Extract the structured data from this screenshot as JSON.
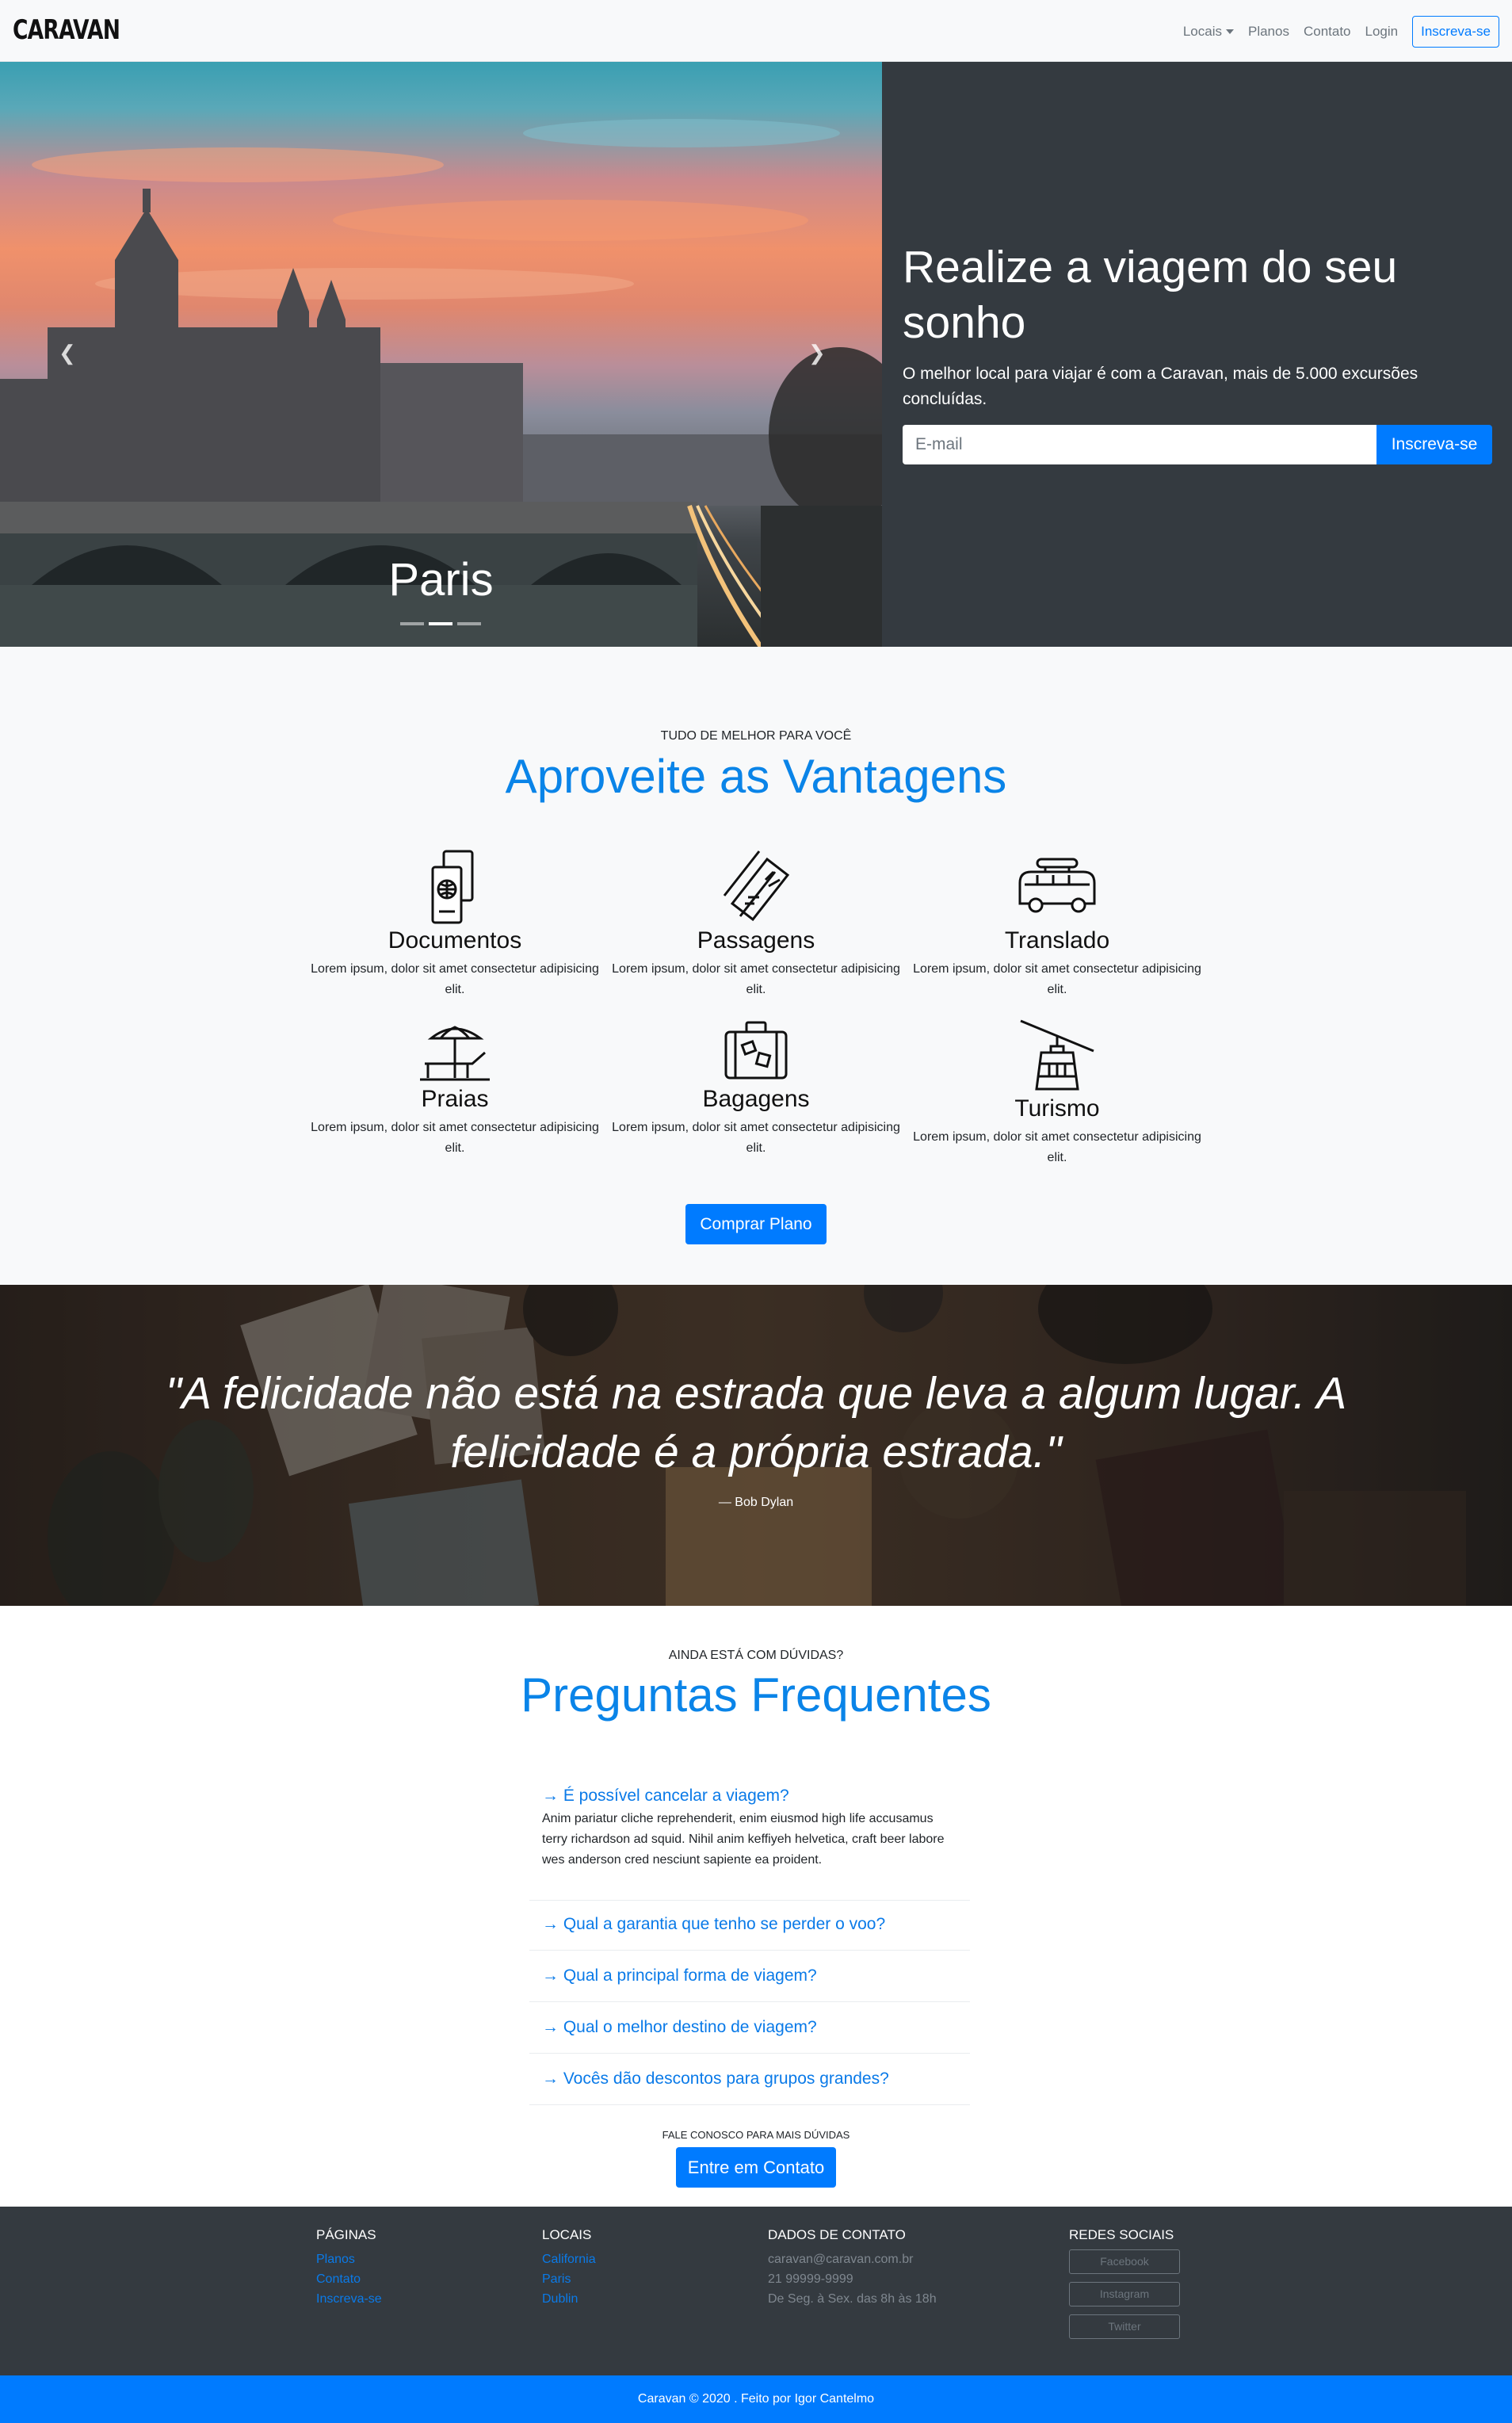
{
  "navbar": {
    "brand": "CARAVAN",
    "items": [
      {
        "label": "Locais",
        "dropdown": true
      },
      {
        "label": "Planos"
      },
      {
        "label": "Contato"
      },
      {
        "label": "Login"
      }
    ],
    "cta_label": "Inscreva-se"
  },
  "hero": {
    "carousel_caption": "Paris",
    "prev_icon": "chevron-left-icon",
    "next_icon": "chevron-right-icon",
    "slides": 3,
    "active_slide": 2,
    "title": "Realize a viagem do seu sonho",
    "subtitle": "O melhor local para viajar é com a Caravan, mais de 5.000 excursões concluídas.",
    "email_placeholder": "E-mail",
    "submit_label": "Inscreva-se"
  },
  "features": {
    "eyebrow": "TUDO DE MELHOR PARA VOCÊ",
    "title": "Aproveite as Vantagens",
    "items": [
      {
        "icon": "passport-icon",
        "title": "Documentos",
        "text": "Lorem ipsum, dolor sit amet consectetur adipisicing elit."
      },
      {
        "icon": "ticket-icon",
        "title": "Passagens",
        "text": "Lorem ipsum, dolor sit amet consectetur adipisicing elit."
      },
      {
        "icon": "van-icon",
        "title": "Translado",
        "text": "Lorem ipsum, dolor sit amet consectetur adipisicing elit."
      },
      {
        "icon": "beach-umbrella-icon",
        "title": "Praias",
        "text": "Lorem ipsum, dolor sit amet consectetur adipisicing elit."
      },
      {
        "icon": "suitcase-icon",
        "title": "Bagagens",
        "text": "Lorem ipsum, dolor sit amet consectetur adipisicing elit."
      },
      {
        "icon": "cable-car-icon",
        "title": "Turismo",
        "text": "Lorem ipsum, dolor sit amet consectetur adipisicing elit."
      }
    ],
    "button_label": "Comprar Plano"
  },
  "quote": {
    "text": "\"A felicidade não está na estrada que leva a algum lugar. A felicidade é a própria estrada.\"",
    "author": "— Bob Dylan"
  },
  "faq": {
    "eyebrow": "AINDA ESTÁ COM DÚVIDAS?",
    "title": "Preguntas Frequentes",
    "items": [
      {
        "question": "→ É possível cancelar a viagem?",
        "answer": "Anim pariatur cliche reprehenderit, enim eiusmod high life accusamus terry richardson ad squid. Nihil anim keffiyeh helvetica, craft beer labore wes anderson cred nesciunt sapiente ea proident.",
        "expanded": true
      },
      {
        "question": "→ Qual a garantia que tenho se perder o voo?",
        "expanded": false
      },
      {
        "question": "→ Qual a principal forma de viagem?",
        "expanded": false
      },
      {
        "question": "→ Qual o melhor destino de viagem?",
        "expanded": false
      },
      {
        "question": "→ Vocês dão descontos para grupos grandes?",
        "expanded": false
      }
    ],
    "contact_eyebrow": "FALE CONOSCO PARA MAIS DÚVIDAS",
    "contact_button": "Entre em Contato"
  },
  "footer": {
    "pages": {
      "title": "PÁGINAS",
      "links": [
        "Planos",
        "Contato",
        "Inscreva-se"
      ]
    },
    "places": {
      "title": "LOCAIS",
      "links": [
        "California",
        "Paris",
        "Dublin"
      ]
    },
    "contact": {
      "title": "DADOS DE CONTATO",
      "lines": [
        "caravan@caravan.com.br",
        "21 99999-9999",
        "De Seg. à Sex. das 8h às 18h"
      ]
    },
    "social": {
      "title": "REDES SOCIAIS",
      "buttons": [
        "Facebook",
        "Instagram",
        "Twitter"
      ]
    },
    "copyright": "Caravan © 2020 . Feito por Igor Cantelmo"
  },
  "colors": {
    "primary": "#007bff",
    "dark": "#343a40",
    "light": "#f8f9fa",
    "heading_blue": "#0a84e8"
  }
}
